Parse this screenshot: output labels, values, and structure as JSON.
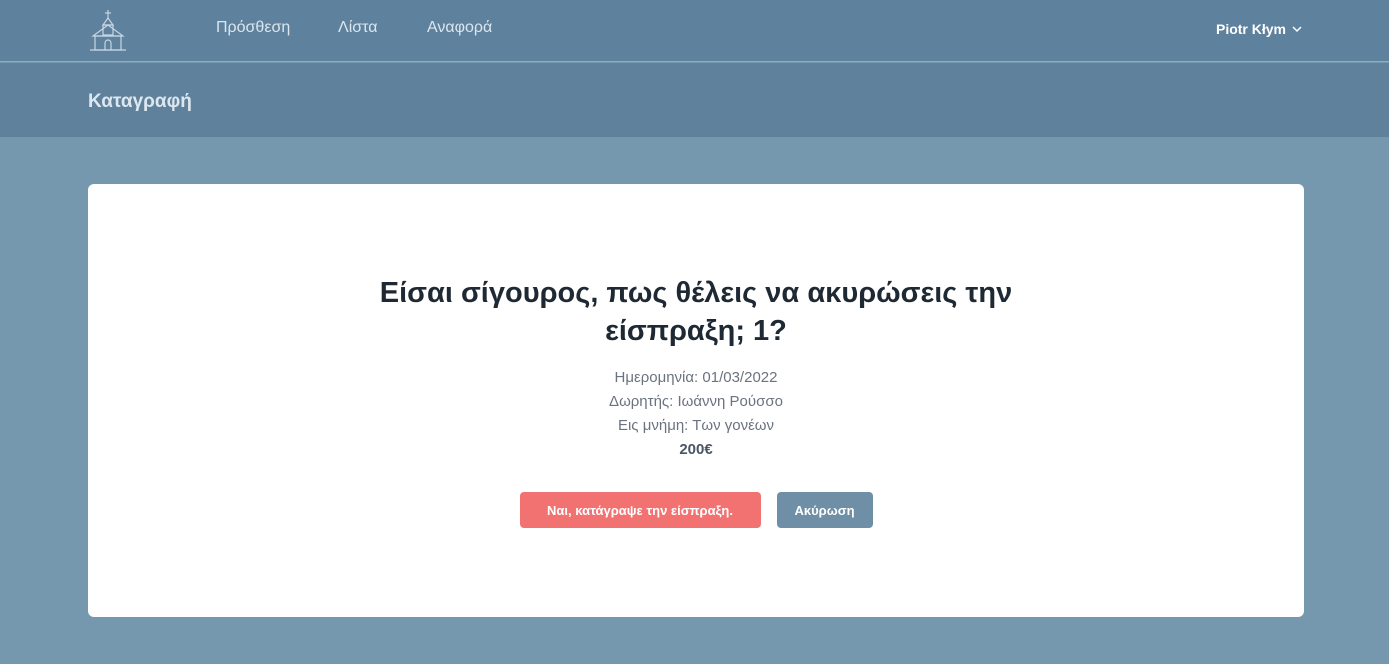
{
  "nav": {
    "links": [
      "Πρόσθεση",
      "Λίστα",
      "Αναφορά"
    ],
    "user_name": "Piotr Kłym"
  },
  "header": {
    "title": "Καταγραφή"
  },
  "dialog": {
    "heading": "Είσαι σίγουρος, πως θέλεις να ακυρώσεις την είσπραξη; 1?",
    "date": "Ημερομηνία: 01/03/2022",
    "donor": "Δωρητής: Ιωάννη Ρούσσο",
    "memory": "Εις μνήμη: Των γονέων",
    "amount": "200€",
    "confirm_label": "Ναι, κατάγραψε την είσπραξη.",
    "cancel_label": "Ακύρωση"
  },
  "colors": {
    "nav_bg": "#5e819d",
    "page_bg": "#7598ae",
    "confirm": "#f27272",
    "cancel": "#6f8fa7"
  },
  "icons": [
    "church-icon",
    "chevron-down-icon"
  ]
}
